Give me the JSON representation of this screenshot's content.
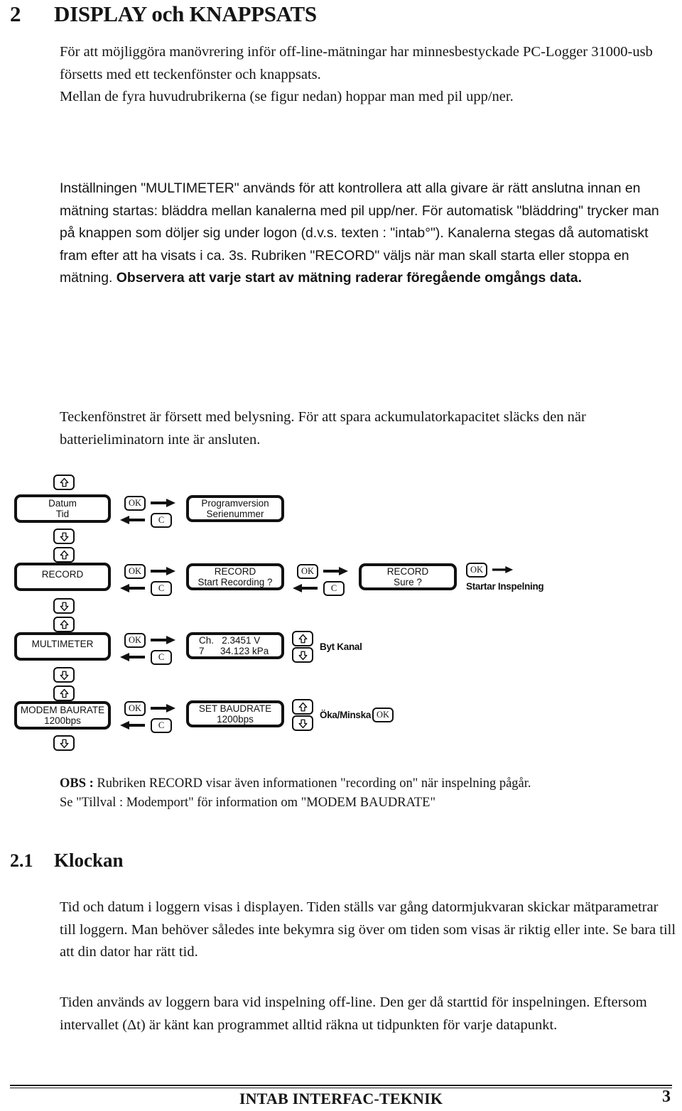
{
  "heading": {
    "number": "2",
    "title": "DISPLAY och KNAPPSATS"
  },
  "paragraphs": {
    "intro": "För att möjliggöra manövrering inför off-line-mätningar har minnesbestyckade PC-Logger 31000-usb försetts med ett teckenfönster och knappsats.\nMellan de fyra huvudrubrikerna (se figur nedan) hoppar man med pil upp/ner.",
    "multimeter_line1": "Inställningen \"MULTIMETER\" används för att kontrollera att alla givare är rätt anslutna innan en mätning startas: bläddra mellan kanalerna med pil upp/ner.",
    "multimeter_line2": "För automatisk \"bläddring\" trycker man på knappen som döljer sig under logon (d.v.s. texten : \"intab°\"). Kanalerna stegas då automatiskt fram efter att ha visats i ca. 3s.",
    "multimeter_line3": "Rubriken \"RECORD\" väljs när man skall starta eller stoppa en mätning.",
    "multimeter_bold": "Observera att varje start av mätning raderar föregående omgångs data.",
    "teckenfonster": "Teckenfönstret är försett med belysning. För att spara ackumulatorkapacitet släcks den när batterieliminatorn inte är ansluten.",
    "obs_label": "OBS :",
    "obs_line1": " Rubriken RECORD visar även informationen \"recording on\" när inspelning pågår.",
    "obs_line2": "Se \"Tillval : Modemport\" för information om \"MODEM BAUDRATE\"",
    "klockan": "Tid och datum i loggern visas i displayen. Tiden ställs var gång datormjukvaran skickar mätparametrar till loggern. Man behöver således inte bekymra sig över om tiden som visas är riktig eller inte. Se bara till att din dator har rätt tid.",
    "tiden": "Tiden används av loggern bara vid inspelning off-line. Den ger då starttid för inspelningen. Eftersom intervallet (Δt) är känt kan programmet alltid räkna ut tidpunkten för varje datapunkt."
  },
  "subheading": {
    "number": "2.1",
    "title": "Klockan"
  },
  "diagram": {
    "keys": {
      "ok": "OK",
      "clear": "C"
    },
    "menus": [
      {
        "main_line1": "Datum",
        "main_line2": "Tid",
        "detail_line1": "Programversion",
        "detail_line2": "Serienummer"
      },
      {
        "main_line1": "RECORD",
        "main_line2": "",
        "detail_line1": "RECORD",
        "detail_line2": "Start Recording ?",
        "detail2_line1": "RECORD",
        "detail2_line2": "Sure ?",
        "action_label": "Startar Inspelning"
      },
      {
        "main_line1": "MULTIMETER",
        "main_line2": "",
        "detail_line1": "Ch.   2.3451 V",
        "detail_line2": "7      34.123 kPa",
        "action_label": "Byt Kanal"
      },
      {
        "main_line1": "MODEM BAURATE",
        "main_line2": "1200bps",
        "detail_line1": "SET BAUDRATE",
        "detail_line2": "1200bps",
        "action_label": "Öka/Minska"
      }
    ]
  },
  "footer": {
    "company": "INTAB INTERFAC-TEKNIK",
    "page": "3"
  },
  "colors": {
    "ink": "#151515",
    "paper": "#ffffff"
  }
}
